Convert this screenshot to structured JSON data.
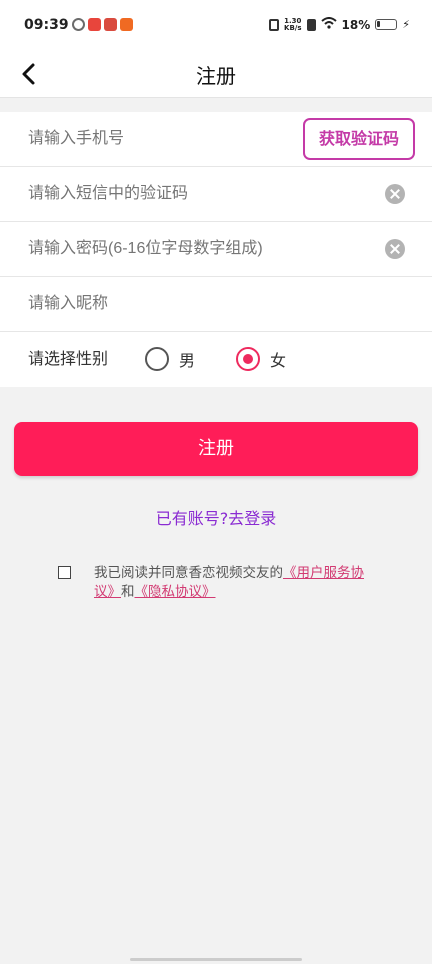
{
  "status_bar": {
    "time": "09:39",
    "app_icon_colors": [
      "#6b6b6b",
      "#e8453c",
      "#d94b3f",
      "#f06a22"
    ],
    "net_speed_value": "1.30",
    "net_speed_unit": "KB/s",
    "battery_percent": "18%"
  },
  "header": {
    "title": "注册"
  },
  "form": {
    "phone_placeholder": "请输入手机号",
    "get_code_label": "获取验证码",
    "sms_code_placeholder": "请输入短信中的验证码",
    "password_placeholder": "请输入密码(6-16位字母数字组成)",
    "nickname_placeholder": "请输入昵称",
    "gender_label": "请选择性别",
    "gender_options": [
      "男",
      "女"
    ],
    "gender_selected": "女"
  },
  "actions": {
    "register_label": "注册",
    "login_link": "已有账号?去登录"
  },
  "agreement": {
    "prefix": "我已阅读并同意香恋视频交友的",
    "user_agreement": "《用户服务协议》",
    "conjunction": "和",
    "privacy_agreement": "《隐私协议》"
  },
  "colors": {
    "primary": "#ff1d58",
    "accent_purple": "#c43aa7",
    "link_purple": "#8a2bd2",
    "link_pink": "#d23a72"
  }
}
